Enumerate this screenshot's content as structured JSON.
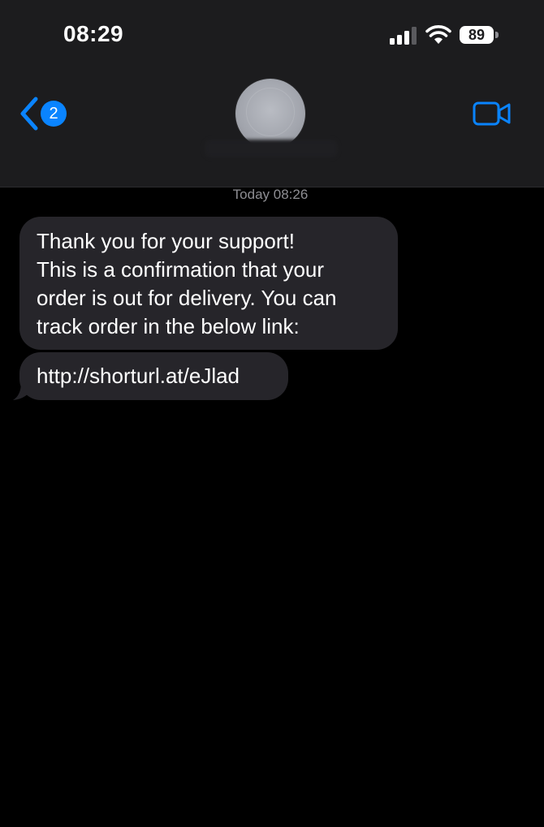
{
  "status_bar": {
    "time": "08:29",
    "battery": "89",
    "icons": [
      "signal-bars-icon",
      "wifi-icon",
      "battery-icon"
    ]
  },
  "nav": {
    "back_badge": "2",
    "icons": [
      "chevron-left-icon",
      "video-camera-icon"
    ],
    "accent_color": "#0a84ff"
  },
  "conversation": {
    "timestamp": "Today 08:26",
    "messages": [
      {
        "lines": [
          "Thank you for your support!",
          "This is a confirmation that your",
          "order is out for delivery. You can",
          "track order in the below link:"
        ]
      },
      {
        "lines": [
          "http://shorturl.at/eJlad"
        ]
      }
    ],
    "bubble_color": "#26252a"
  }
}
